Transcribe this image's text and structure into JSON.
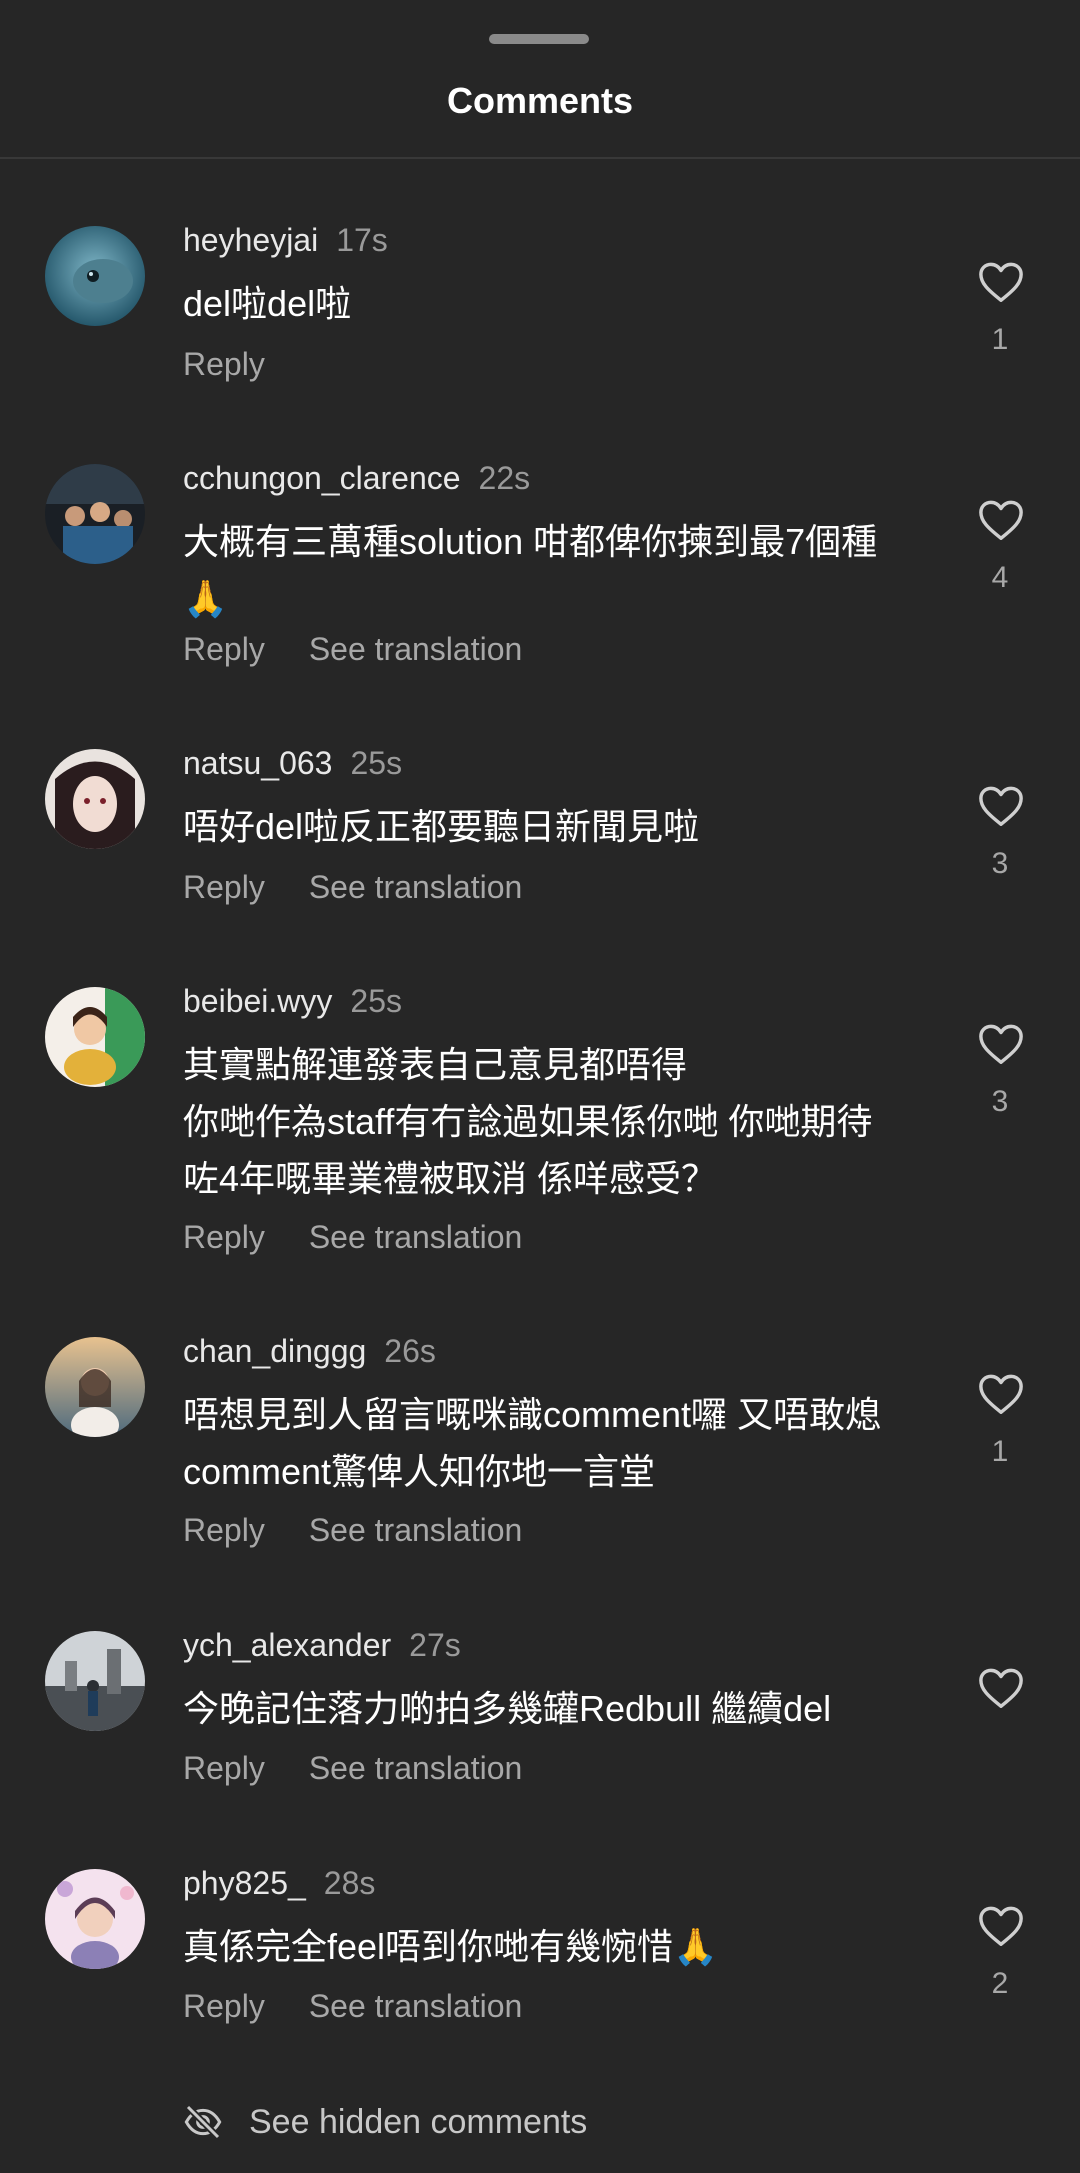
{
  "header": {
    "title": "Comments"
  },
  "comments": [
    {
      "username": "heyheyjai",
      "time": "17s",
      "lines": [
        "del啦del啦"
      ],
      "reply_label": "Reply",
      "translate_label": "",
      "likes": "1",
      "avatar_icon": "fish-photo-avatar",
      "avatar_colors": [
        "#5e9fb5",
        "#1d4f63"
      ]
    },
    {
      "username": "cchungon_clarence",
      "time": "22s",
      "lines": [
        "大概有三萬種solution 咁都俾你揀到最7個種",
        "🙏"
      ],
      "reply_label": "Reply",
      "translate_label": "See translation",
      "likes": "4",
      "avatar_icon": "group-photo-avatar",
      "avatar_colors": [
        "#4a5b6a",
        "#14181d"
      ]
    },
    {
      "username": "natsu_063",
      "time": "25s",
      "lines": [
        "唔好del啦反正都要聽日新聞見啦"
      ],
      "reply_label": "Reply",
      "translate_label": "See translation",
      "likes": "3",
      "avatar_icon": "anime-drawing-avatar",
      "avatar_colors": [
        "#ece6e2",
        "#3b2a2a"
      ]
    },
    {
      "username": "beibei.wyy",
      "time": "25s",
      "lines": [
        "其實點解連發表自己意見都唔得",
        "你哋作為staff有冇諗過如果係你哋 你哋期待",
        "咗4年嘅畢業禮被取消 係咩感受？"
      ],
      "reply_label": "Reply",
      "translate_label": "See translation",
      "likes": "3",
      "avatar_icon": "portrait-photo-avatar",
      "avatar_colors": [
        "#f2c59a",
        "#2f8f4e"
      ]
    },
    {
      "username": "chan_dinggg",
      "time": "26s",
      "lines": [
        "唔想見到人留言嘅咪識comment囉 又唔敢熄",
        "comment驚俾人知你地一言堂"
      ],
      "reply_label": "Reply",
      "translate_label": "See translation",
      "likes": "1",
      "avatar_icon": "sunset-portrait-avatar",
      "avatar_colors": [
        "#d9b48a",
        "#4d6a7e"
      ]
    },
    {
      "username": "ych_alexander",
      "time": "27s",
      "lines": [
        "今晚記住落力啲拍多幾罐Redbull 繼續del"
      ],
      "reply_label": "Reply",
      "translate_label": "See translation",
      "likes": "",
      "avatar_icon": "castle-photo-avatar",
      "avatar_colors": [
        "#c9ccd0",
        "#3f464c"
      ]
    },
    {
      "username": "phy825_",
      "time": "28s",
      "lines": [
        "真係完全feel唔到你哋有幾惋惜🙏"
      ],
      "reply_label": "Reply",
      "translate_label": "See translation",
      "likes": "2",
      "avatar_icon": "sticker-portrait-avatar",
      "avatar_colors": [
        "#f3d6e6",
        "#7a6f9e"
      ]
    }
  ],
  "footer": {
    "hidden_comments_label": "See hidden comments",
    "icon": "eye-off-icon"
  }
}
